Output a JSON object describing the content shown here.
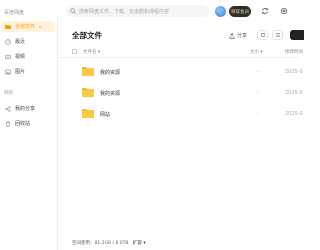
{
  "app": {
    "title": "百度网盘"
  },
  "search": {
    "placeholder": "搜索网盘文件、下载、云追剧和课程内容"
  },
  "header": {
    "vip_label": "领取会员"
  },
  "sidebar": {
    "items": [
      {
        "label": "全部文件",
        "icon": "folder-icon",
        "active": true
      },
      {
        "label": "最近",
        "icon": "clock-icon"
      },
      {
        "label": "视频",
        "icon": "video-icon"
      },
      {
        "label": "图片",
        "icon": "image-icon"
      }
    ],
    "section_label": "网络",
    "extra_items": [
      {
        "label": "我的分享",
        "icon": "share-icon"
      },
      {
        "label": "回收站",
        "icon": "trash-icon"
      }
    ]
  },
  "main": {
    "title": "全部文件",
    "share_label": "分享",
    "columns": {
      "name": "文件名",
      "size": "大小",
      "date": "修改时间"
    },
    "files": [
      {
        "name": "我的资源",
        "size": "-",
        "date": "2025-0"
      },
      {
        "name": "我的资源",
        "size": "-",
        "date": "2025-0"
      },
      {
        "name": "网站",
        "size": "-",
        "date": "2025-0"
      }
    ],
    "footer": {
      "storage": "空间使用：81.2GB / 6.0TB",
      "expand": "扩容"
    }
  },
  "colors": {
    "accent": "#f0a500",
    "folder": "#f7b82e",
    "vip_bg": "#2d2d30"
  }
}
